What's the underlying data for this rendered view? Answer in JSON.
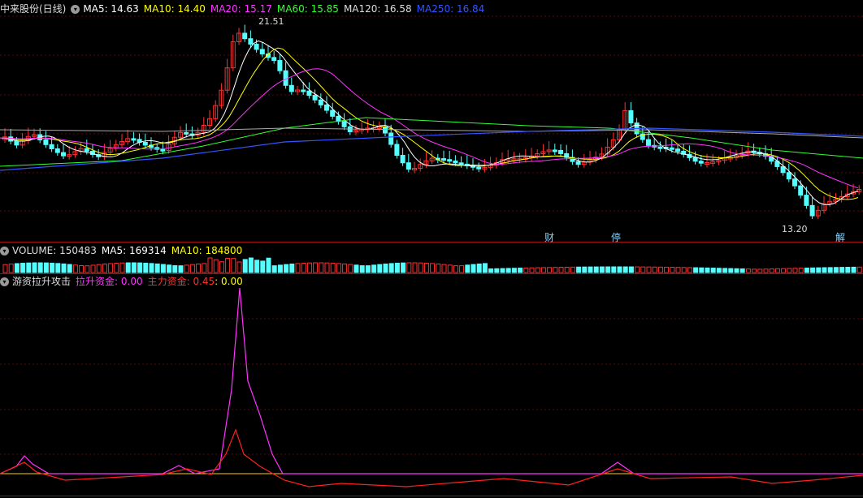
{
  "main_header": {
    "title": "中来股份(日线)",
    "ma": [
      {
        "label": "MA5: 14.63",
        "color": "#ffffff"
      },
      {
        "label": "MA10: 14.40",
        "color": "#ffff00"
      },
      {
        "label": "MA20: 15.17",
        "color": "#ff33ff"
      },
      {
        "label": "MA60: 15.85",
        "color": "#33ff33"
      },
      {
        "label": "MA120: 16.58",
        "color": "#dddddd"
      },
      {
        "label": "MA250: 16.84",
        "color": "#3355ff"
      }
    ]
  },
  "price_annotations": {
    "high": "21.51",
    "low": "13.20"
  },
  "markers": {
    "cai": "财",
    "ting": "停",
    "jie": "解"
  },
  "volume_header": {
    "title": "VOLUME: 150483",
    "ma5": "MA5: 169314",
    "ma10": "MA10: 184800"
  },
  "indicator_header": {
    "title": "游资拉升攻击",
    "lift_label": "拉升资金: 0.00",
    "main_label": "主力资金: 0.45",
    "extra_label": ": 0.00"
  },
  "colors": {
    "up": "#ff3030",
    "down": "#54ffff",
    "lift": "#ff33ff",
    "main": "#ff2020",
    "zero": "#ffd000"
  }
}
